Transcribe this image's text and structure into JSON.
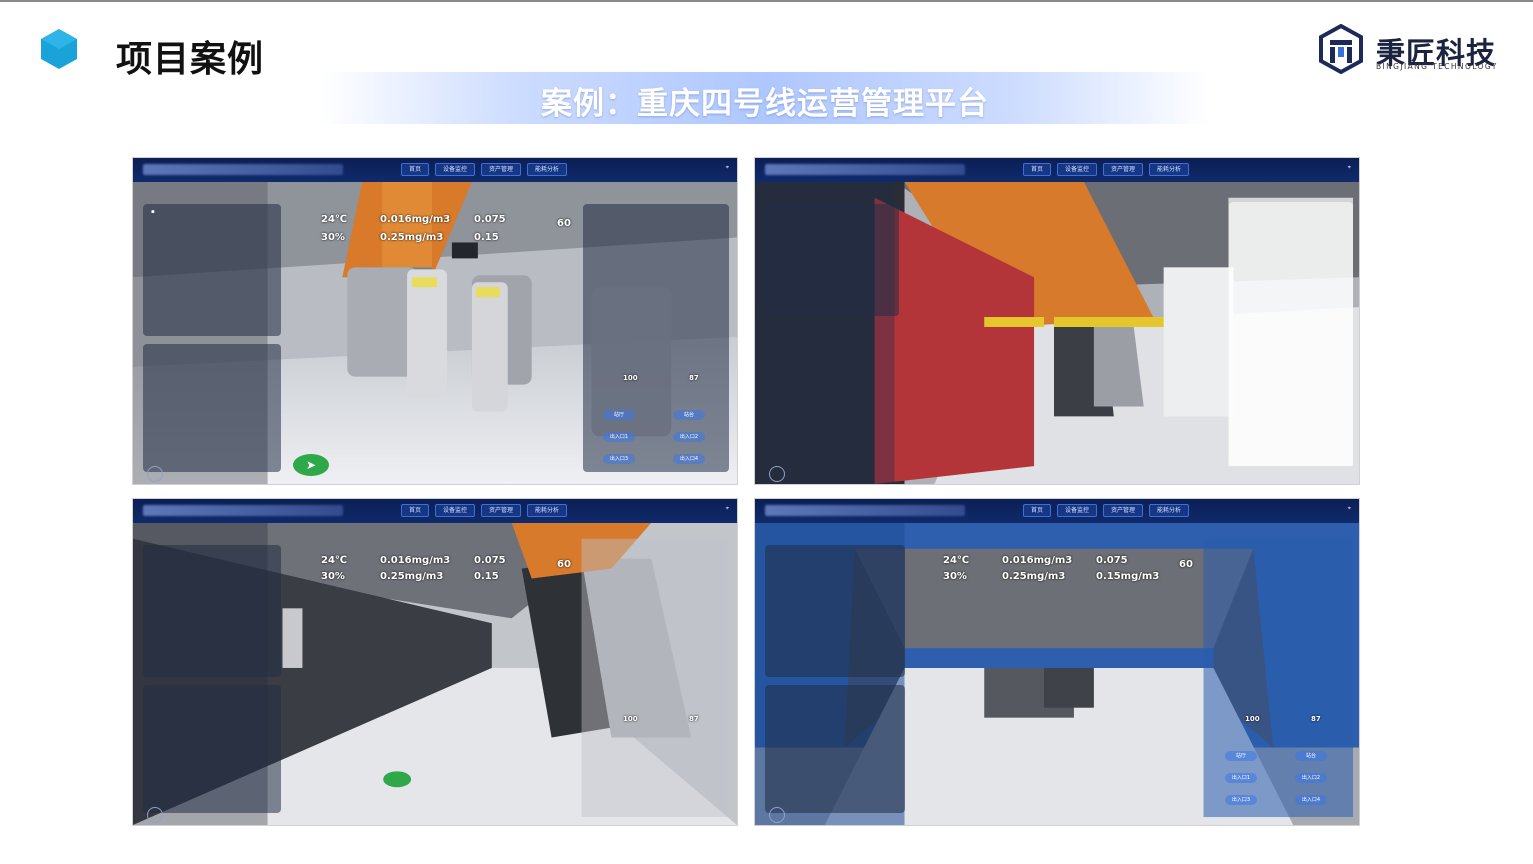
{
  "header": {
    "title": "项目案例",
    "hex_color": "#1aa3d9"
  },
  "logo": {
    "name": "秉匠科技",
    "subtitle": "BINGJIANG TECHNOLOGY",
    "mark_color": "#1c2a5a"
  },
  "banner": {
    "text": "案例：重庆四号线运营管理平台"
  },
  "shots": [
    {
      "nav": [
        "首页",
        "设备监控",
        "资产管理",
        "能耗分析"
      ],
      "metrics": [
        "24℃",
        "30%",
        "0.016mg/m3",
        "0.25mg/m3",
        "0.075",
        "0.15",
        "60"
      ],
      "bottom": [
        "100",
        "87"
      ],
      "buttons": [
        "站厅",
        "站台",
        "出入口1",
        "出入口2",
        "出入口3",
        "出入口4"
      ]
    },
    {
      "nav": [
        "首页",
        "设备监控",
        "资产管理",
        "能耗分析"
      ]
    },
    {
      "nav": [
        "首页",
        "设备监控",
        "资产管理",
        "能耗分析"
      ],
      "metrics": [
        "24℃",
        "30%",
        "0.016mg/m3",
        "0.25mg/m3",
        "0.075",
        "0.15",
        "60"
      ],
      "bottom": [
        "100",
        "87"
      ]
    },
    {
      "nav": [
        "首页",
        "设备监控",
        "资产管理",
        "能耗分析"
      ],
      "metrics": [
        "24℃",
        "30%",
        "0.016mg/m3",
        "0.25mg/m3",
        "0.075",
        "0.15mg/m3",
        "60"
      ],
      "bottom": [
        "100",
        "87"
      ],
      "buttons": [
        "站厅",
        "站台",
        "出入口1",
        "出入口2",
        "出入口3",
        "出入口4"
      ]
    }
  ]
}
